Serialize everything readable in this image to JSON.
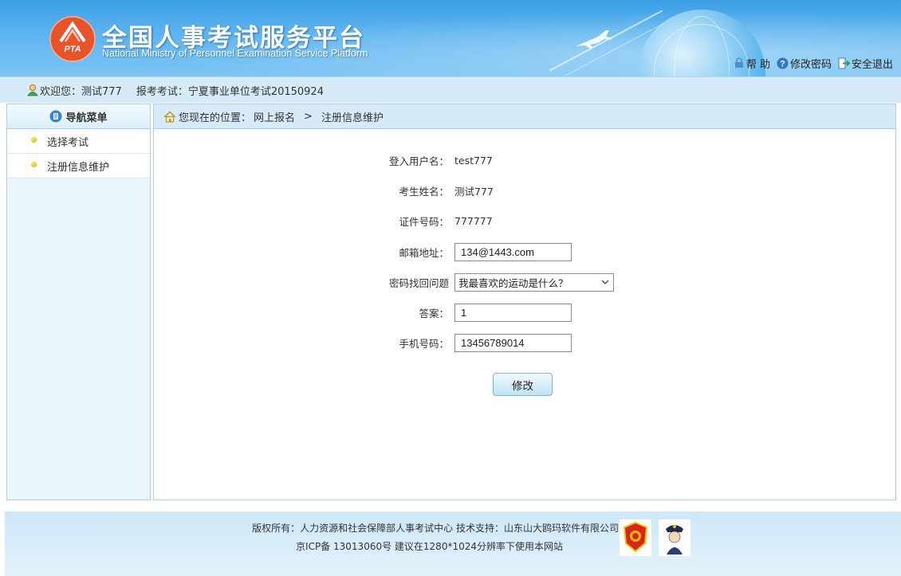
{
  "header": {
    "title_cn": "全国人事考试服务平台",
    "title_en": "National Ministry of Personnel Examination Service Platform",
    "logo_text": "PTA",
    "links": [
      {
        "label": "帮 助",
        "icon": "lock-user-icon"
      },
      {
        "label": "修改密码",
        "icon": "question-icon"
      },
      {
        "label": "安全退出",
        "icon": "exit-icon"
      }
    ]
  },
  "welcome": {
    "greeting": "欢迎您：测试777",
    "exam": "报考考试：宁夏事业单位考试20150924"
  },
  "sidebar": {
    "title": "导航菜单",
    "items": [
      {
        "label": "选择考试"
      },
      {
        "label": "注册信息维护"
      }
    ]
  },
  "breadcrumb": {
    "prefix": "您现在的位置：",
    "level1": "网上报名",
    "separator": ">",
    "level2": "注册信息维护"
  },
  "form": {
    "username_label": "登入用户名：",
    "username_value": "test777",
    "name_label": "考生姓名：",
    "name_value": "测试777",
    "id_label": "证件号码：",
    "id_value": "777777",
    "email_label": "邮箱地址：",
    "email_value": "134@1443.com",
    "question_label": "密码找回问题",
    "question_value": "我最喜欢的运动是什么？",
    "answer_label": "答案：",
    "answer_value": "1",
    "phone_label": "手机号码：",
    "phone_value": "13456789014",
    "submit_label": "修改"
  },
  "footer": {
    "line1": "版权所有：人力资源和社会保障部人事考试中心  技术支持：山东山大鸥玛软件有限公司",
    "line2": "京ICP备 13013060号  建议在1280*1024分辨率下使用本网站"
  },
  "colors": {
    "header_blue": "#3d9fe6",
    "bar_blue": "#d6ebf7",
    "border_blue": "#a9d0ea"
  }
}
